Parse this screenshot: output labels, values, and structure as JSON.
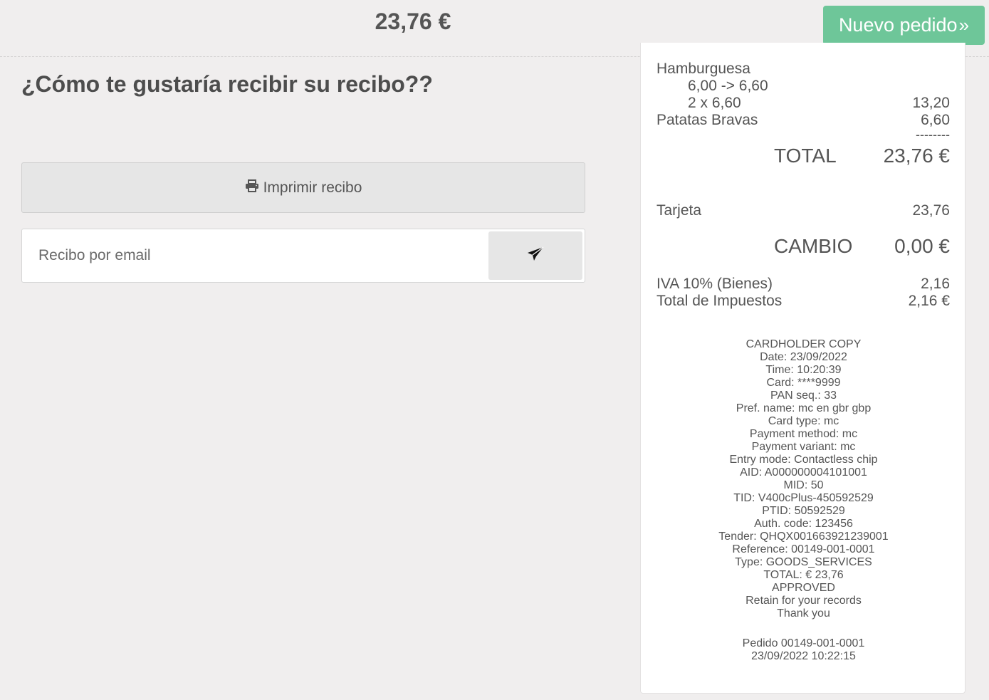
{
  "header": {
    "total": "23,76 €",
    "new_order_label": "Nuevo pedido",
    "new_order_icon": "double-chevron-right-icon",
    "accent_color": "#6ec699"
  },
  "main": {
    "question": "¿Cómo te gustaría recibir su recibo??",
    "print_label": "Imprimir recibo",
    "print_icon": "printer-icon",
    "email_placeholder": "Recibo por email",
    "send_icon": "paper-plane-icon"
  },
  "receipt": {
    "items": [
      {
        "name": "Hamburguesa",
        "amount": ""
      },
      {
        "name": "6,00 -> 6,60",
        "amount": ""
      },
      {
        "name": "2 x 6,60",
        "amount": "13,20"
      },
      {
        "name": "Patatas Bravas",
        "amount": "6,60"
      }
    ],
    "separator": "--------",
    "total_label": "TOTAL",
    "total_value": "23,76 €",
    "payment_label": "Tarjeta",
    "payment_value": "23,76",
    "change_label": "CAMBIO",
    "change_value": "0,00 €",
    "tax_label": "IVA 10% (Bienes)",
    "tax_value": "2,16",
    "tax_total_label": "Total de Impuestos",
    "tax_total_value": "2,16 €",
    "card_copy": [
      "CARDHOLDER COPY",
      "Date: 23/09/2022",
      "Time: 10:20:39",
      "Card: ****9999",
      "PAN seq.: 33",
      "Pref. name: mc en gbr gbp",
      "Card type: mc",
      "Payment method: mc",
      "Payment variant: mc",
      "Entry mode: Contactless chip",
      "AID: A000000004101001",
      "MID: 50",
      "TID: V400cPlus-450592529",
      "PTID: 50592529",
      "Auth. code: 123456",
      "Tender: QHQX001663921239001",
      "Reference: 00149-001-0001",
      "Type: GOODS_SERVICES",
      "TOTAL: € 23,76",
      "APPROVED",
      "Retain for your records",
      "Thank you"
    ],
    "order_number": "Pedido 00149-001-0001",
    "order_datetime": "23/09/2022 10:22:15"
  }
}
